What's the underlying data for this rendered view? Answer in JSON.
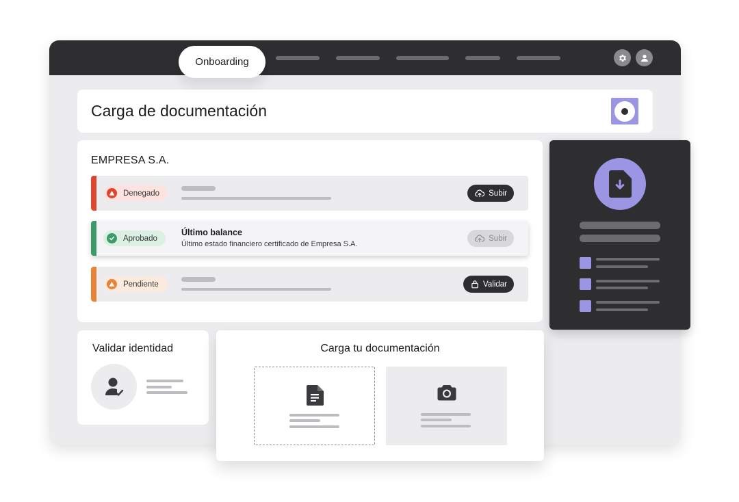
{
  "nav": {
    "active_tab": "Onboarding",
    "icons": [
      "gear-icon",
      "user-icon"
    ]
  },
  "header": {
    "title": "Carga de documentación",
    "logo_icon": "brand-logo"
  },
  "documents": {
    "company": "EMPRESA S.A.",
    "rows": [
      {
        "status": "Denegado",
        "status_color": "#e0452f",
        "status_icon": "warning-icon",
        "title": "",
        "description": "",
        "action": "Subir",
        "action_icon": "upload-cloud-icon",
        "action_enabled": true
      },
      {
        "status": "Aprobado",
        "status_color": "#3d9a6a",
        "status_icon": "check-icon",
        "title": "Último balance",
        "description": "Último estado financiero certificado de Empresa S.A.",
        "action": "Subir",
        "action_icon": "upload-cloud-icon",
        "action_enabled": false
      },
      {
        "status": "Pendiente",
        "status_color": "#e8843a",
        "status_icon": "warning-icon",
        "title": "",
        "description": "",
        "action": "Validar",
        "action_icon": "lock-icon",
        "action_enabled": true
      }
    ]
  },
  "download_panel": {
    "icon": "file-download-icon"
  },
  "identity": {
    "title": "Validar identidad",
    "icon": "verified-user-icon"
  },
  "upload": {
    "title": "Carga tu documentación",
    "options": [
      {
        "icon": "document-icon",
        "style": "dashed"
      },
      {
        "icon": "camera-icon",
        "style": "filled"
      }
    ]
  },
  "colors": {
    "accent": "#9b95e4",
    "dark": "#2e2e31",
    "background": "#ececee"
  }
}
